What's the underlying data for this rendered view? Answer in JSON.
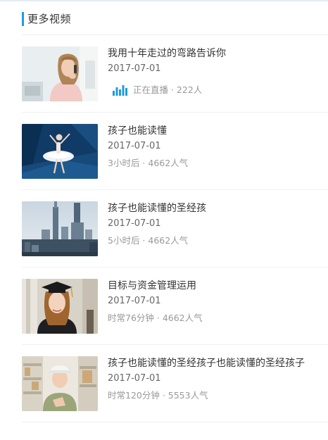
{
  "section": {
    "title": "更多视频"
  },
  "videos": [
    {
      "title": "我用十年走过的弯路告诉你",
      "date": "2017-07-01",
      "meta": "正在直播 · 222人",
      "live": true,
      "thumb_icon": "woman-on-phone"
    },
    {
      "title": "孩子也能读懂",
      "date": "2017-07-01",
      "meta": "3小时后 · 4662人气",
      "live": false,
      "thumb_icon": "ballet-dancer"
    },
    {
      "title": "孩子也能读懂的圣经孩",
      "date": "2017-07-01",
      "meta": "5小时后 · 4662人气",
      "live": false,
      "thumb_icon": "city-skyline"
    },
    {
      "title": "目标与资金管理运用",
      "date": "2017-07-01",
      "meta": "时常76分钟 · 4662人气",
      "live": false,
      "thumb_icon": "graduate"
    },
    {
      "title": "孩子也能读懂的圣经孩子也能读懂的圣经孩子",
      "date": "2017-07-01",
      "meta": "时常120分钟 · 5553人气",
      "live": false,
      "thumb_icon": "warehouse-worker"
    }
  ],
  "colors": {
    "accent": "#1f9be0",
    "title": "#333333",
    "date": "#666666",
    "meta": "#999999",
    "divider": "#f0f0f0"
  }
}
